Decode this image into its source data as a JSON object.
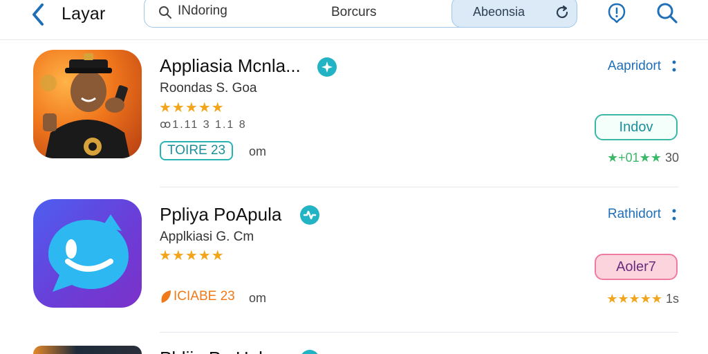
{
  "header": {
    "back_label": "Layar",
    "search_placeholder": "INdoring",
    "search_middle_text": "Borcurs",
    "chip_label": "Abeonsia",
    "icons": {
      "back": "chevron-left-icon",
      "search": "search-icon",
      "refresh": "refresh-icon",
      "alert": "alert-icon"
    },
    "accent_color": "#1f6fb8"
  },
  "apps": [
    {
      "name": "Appliasia Mcnla...",
      "developer": "Roondas S. Goa",
      "stars": "★★★★★",
      "meta": "ꝏ1.11 3 1.1 8",
      "badge": "TOIRE 23",
      "badge_suffix": "om",
      "status": "Aapridort",
      "action": "Indov",
      "small_rating_stars": "★+01★★",
      "small_rating_count": "30",
      "action_color": "#3bb8a5",
      "small_rating_color": "#3bb86a"
    },
    {
      "name": "Ppliya PoApula",
      "developer": "Applkiasi G. Cm",
      "stars": "★★★★★",
      "badge": "ICIABE 23",
      "badge_suffix": "om",
      "status": "Rathidort",
      "action": "Aoler7",
      "small_rating_stars": "★★★★★",
      "small_rating_count": "1s",
      "action_color": "#f07aa0",
      "small_rating_color": "#f2a51a"
    },
    {
      "name": "Pbliia Pa Hula"
    }
  ]
}
